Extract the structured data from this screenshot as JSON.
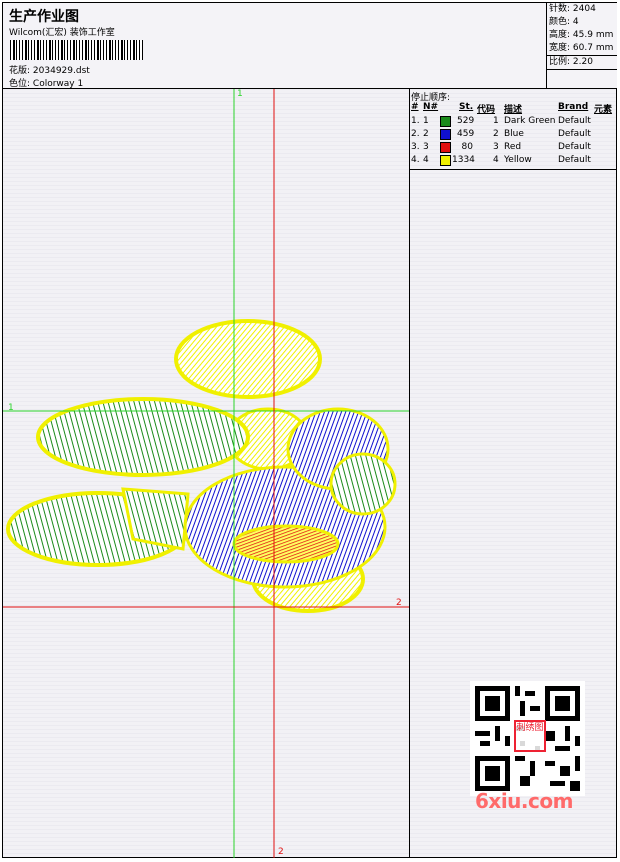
{
  "header": {
    "title": "生产作业图",
    "company": "Wilcom(汇宏) 装饰工作室",
    "design_label": "花版:",
    "design_value": "2034929.dst",
    "colorway_label": "色位:",
    "colorway_value": "Colorway 1"
  },
  "stats": {
    "stitches_label": "针数:",
    "stitches_value": "2404",
    "colors_label": "颜色:",
    "colors_value": "4",
    "height_label": "高度:",
    "height_value": "45.9 mm",
    "width_label": "宽度:",
    "width_value": "60.7 mm",
    "ratio_label": "比例:",
    "ratio_value": "2.20"
  },
  "sequence": {
    "title": "停止顺序:",
    "headers": {
      "num": "#",
      "no": "N#",
      "st": "St.",
      "code": "代码",
      "desc": "描述",
      "brand": "Brand",
      "elem": "元素"
    },
    "rows": [
      {
        "num": "1.",
        "no": "1",
        "color": "#1a8a1a",
        "st": "529",
        "code": "1",
        "desc": "Dark Green",
        "brand": "Default"
      },
      {
        "num": "2.",
        "no": "2",
        "color": "#1010d0",
        "st": "459",
        "code": "2",
        "desc": "Blue",
        "brand": "Default"
      },
      {
        "num": "3.",
        "no": "3",
        "color": "#e01010",
        "st": "80",
        "code": "3",
        "desc": "Red",
        "brand": "Default"
      },
      {
        "num": "4.",
        "no": "4",
        "color": "#f0f000",
        "st": "1334",
        "code": "4",
        "desc": "Yellow",
        "brand": "Default"
      }
    ]
  },
  "axes": {
    "green_v": "1",
    "green_h": "1",
    "red_h": "2",
    "red_v": "2"
  },
  "watermark": "6xiu.com",
  "stamp": "刺绣图"
}
